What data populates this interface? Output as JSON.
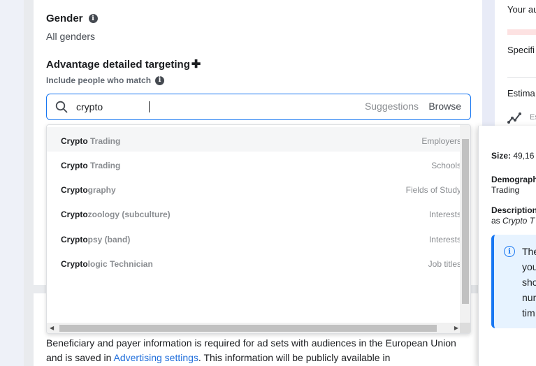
{
  "gender": {
    "title": "Gender",
    "value": "All genders"
  },
  "detailed_targeting": {
    "title": "Advantage detailed targeting",
    "subtitle": "Include people who match"
  },
  "search": {
    "value": "crypto",
    "tabs": {
      "suggestions": "Suggestions",
      "browse": "Browse"
    }
  },
  "dropdown": {
    "items": [
      {
        "match": "Crypto",
        "rest": " Trading",
        "type": "Employers"
      },
      {
        "match": "Crypto",
        "rest": " Trading",
        "type": "Schools"
      },
      {
        "match": "Crypto",
        "rest": "graphy",
        "type": "Fields of Study"
      },
      {
        "match": "Crypto",
        "rest": "zoology (subculture)",
        "type": "Interests"
      },
      {
        "match": "Crypto",
        "rest": "psy (band)",
        "type": "Interests"
      },
      {
        "match": "Crypto",
        "rest": "logic Technician",
        "type": "Job titles"
      }
    ]
  },
  "body": {
    "text_before": "Beneficiary and payer information is required for ad sets with audiences in the European Union and is saved in ",
    "link": "Advertising settings",
    "text_after": ". This information will be publicly available in"
  },
  "right_panel": {
    "line1": "Your au",
    "line2": "Specifi",
    "line3": "Estima",
    "line4": "Es"
  },
  "tooltip": {
    "size_label": "Size:",
    "size_value": "49,16",
    "demographic_label": "Demograph",
    "demographic_value": "Trading",
    "description_label": "Description",
    "description_prefix": "as ",
    "description_value": "Crypto T",
    "notice_lines": [
      "The",
      "you",
      "sho",
      "num",
      "tim"
    ]
  }
}
